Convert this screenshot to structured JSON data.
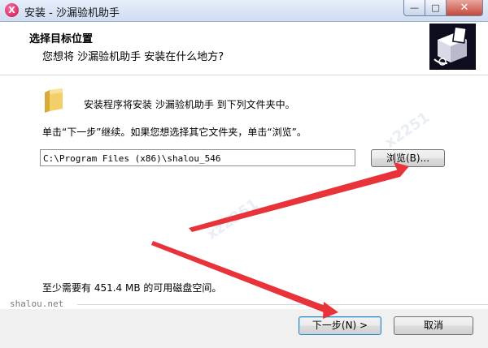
{
  "window": {
    "app_icon_glyph": "X",
    "title": "安装 - 沙漏验机助手",
    "controls": {
      "minimize": "—",
      "maximize": "□",
      "close": "✕"
    }
  },
  "header": {
    "title": "选择目标位置",
    "subtitle": "您想将 沙漏验机助手 安装在什么地方?"
  },
  "body": {
    "intro": "安装程序将安装 沙漏验机助手 到下列文件夹中。",
    "instruction": "单击“下一步”继续。如果您想选择其它文件夹，单击“浏览”。",
    "install_path": "C:\\Program Files (x86)\\shalou_546",
    "browse_label": "浏览(B)...",
    "space_required": "至少需要有 451.4 MB 的可用磁盘空间。"
  },
  "watermark": {
    "site": "shalou.net"
  },
  "footer": {
    "next_label": "下一步(N) >",
    "cancel_label": "取消"
  },
  "colors": {
    "arrow": "#e8333a",
    "title_bar": "#cfdcf0",
    "logo_bg": "#0d0d1e"
  },
  "icons": [
    "app-icon",
    "folder-icon",
    "installer-logo-icon"
  ]
}
